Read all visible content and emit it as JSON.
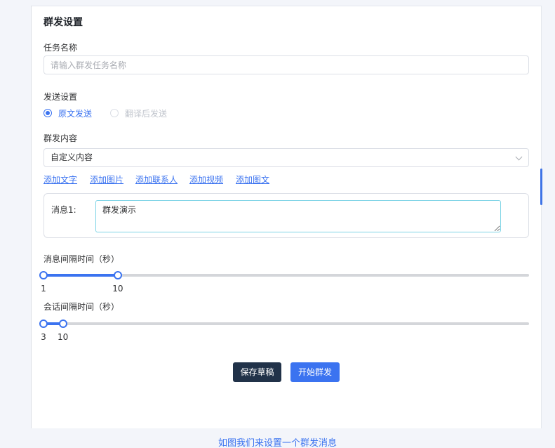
{
  "form": {
    "title": "群发设置",
    "task_name": {
      "label": "任务名称",
      "value": "",
      "placeholder": "请输入群发任务名称"
    },
    "send_settings": {
      "label": "发送设置",
      "options": [
        {
          "label": "原文发送",
          "checked": true
        },
        {
          "label": "翻译后发送",
          "checked": false
        }
      ]
    },
    "content": {
      "label": "群发内容",
      "selected": "自定义内容",
      "add_links": [
        "添加文字",
        "添加图片",
        "添加联系人",
        "添加视频",
        "添加图文"
      ],
      "message": {
        "label": "消息1:",
        "value": "群发演示"
      }
    },
    "message_interval": {
      "label": "消息间隔时间（秒）",
      "min_value": "1",
      "max_value": "10",
      "range_fraction": [
        0.0,
        0.153
      ]
    },
    "session_interval": {
      "label": "会话间隔时间（秒）",
      "min_value": "3",
      "max_value": "10",
      "range_fraction": [
        0.0,
        0.04
      ]
    },
    "buttons": {
      "save_draft": "保存草稿",
      "start": "开始群发"
    }
  },
  "caption": "如图我们来设置一个群发消息",
  "colors": {
    "accent": "#3b73f0",
    "dark_button": "#213249",
    "textarea_border": "#7fd4e6"
  },
  "icons": {
    "select_arrow": "chevron-down-icon"
  }
}
